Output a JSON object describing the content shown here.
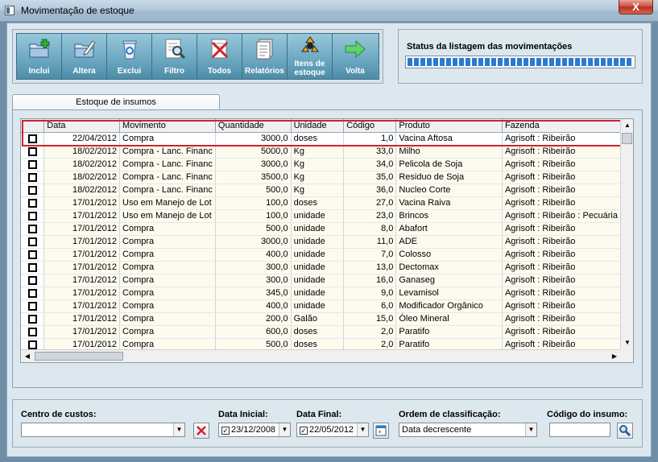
{
  "window": {
    "title": "Movimentação de estoque",
    "close_label": "X"
  },
  "toolbar": {
    "buttons": [
      {
        "label": "Inclui",
        "icon": "folder-add-icon"
      },
      {
        "label": "Altera",
        "icon": "folder-edit-icon"
      },
      {
        "label": "Exclui",
        "icon": "recycle-bin-icon"
      },
      {
        "label": "Filtro",
        "icon": "filter-magnifier-icon"
      },
      {
        "label": "Todos",
        "icon": "clear-filter-icon"
      },
      {
        "label": "Relatórios",
        "icon": "report-icon"
      },
      {
        "label": "Itens de estoque",
        "icon": "stock-items-icon"
      },
      {
        "label": "Volta",
        "icon": "arrow-back-icon"
      }
    ]
  },
  "status": {
    "title": "Status da listagem das movimentações",
    "progress": 1.0
  },
  "tab": {
    "label": "Estoque de insumos"
  },
  "grid": {
    "columns": [
      "Data",
      "Movimento",
      "Quantidade",
      "Unidade",
      "Código",
      "Produto",
      "Fazenda"
    ],
    "rows": [
      [
        "22/04/2012",
        "Compra",
        "3000,0",
        "doses",
        "1,0",
        "Vacina Aftosa",
        "Agrisoft : Ribeirão"
      ],
      [
        "18/02/2012",
        "Compra - Lanc. Financ",
        "5000,0",
        "Kg",
        "33,0",
        "Milho",
        "Agrisoft : Ribeirão"
      ],
      [
        "18/02/2012",
        "Compra - Lanc. Financ",
        "3000,0",
        "Kg",
        "34,0",
        "Pelicola de Soja",
        "Agrisoft : Ribeirão"
      ],
      [
        "18/02/2012",
        "Compra - Lanc. Financ",
        "3500,0",
        "Kg",
        "35,0",
        "Residuo de Soja",
        "Agrisoft : Ribeirão"
      ],
      [
        "18/02/2012",
        "Compra - Lanc. Financ",
        "500,0",
        "Kg",
        "36,0",
        "Nucleo Corte",
        "Agrisoft : Ribeirão"
      ],
      [
        "17/01/2012",
        "Uso em Manejo de Lot",
        "100,0",
        "doses",
        "27,0",
        "Vacina Raiva",
        "Agrisoft : Ribeirão"
      ],
      [
        "17/01/2012",
        "Uso em Manejo de Lot",
        "100,0",
        "unidade",
        "23,0",
        "Brincos",
        "Agrisoft : Ribeirão : Pecuária"
      ],
      [
        "17/01/2012",
        "Compra",
        "500,0",
        "unidade",
        "8,0",
        "Abafort",
        "Agrisoft : Ribeirão"
      ],
      [
        "17/01/2012",
        "Compra",
        "3000,0",
        "unidade",
        "11,0",
        "ADE",
        "Agrisoft : Ribeirão"
      ],
      [
        "17/01/2012",
        "Compra",
        "400,0",
        "unidade",
        "7,0",
        "Colosso",
        "Agrisoft : Ribeirão"
      ],
      [
        "17/01/2012",
        "Compra",
        "300,0",
        "unidade",
        "13,0",
        "Dectomax",
        "Agrisoft : Ribeirão"
      ],
      [
        "17/01/2012",
        "Compra",
        "300,0",
        "unidade",
        "16,0",
        "Ganaseg",
        "Agrisoft : Ribeirão"
      ],
      [
        "17/01/2012",
        "Compra",
        "345,0",
        "unidade",
        "9,0",
        "Levamisol",
        "Agrisoft : Ribeirão"
      ],
      [
        "17/01/2012",
        "Compra",
        "400,0",
        "unidade",
        "6,0",
        "Modificador Orgânico",
        "Agrisoft : Ribeirão"
      ],
      [
        "17/01/2012",
        "Compra",
        "200,0",
        "Galão",
        "15,0",
        "Óleo Mineral",
        "Agrisoft : Ribeirão"
      ],
      [
        "17/01/2012",
        "Compra",
        "600,0",
        "doses",
        "2,0",
        "Paratifo",
        "Agrisoft : Ribeirão"
      ],
      [
        "17/01/2012",
        "Compra",
        "500,0",
        "doses",
        "2,0",
        "Paratifo",
        "Agrisoft : Ribeirão"
      ]
    ]
  },
  "filters": {
    "centro_label": "Centro de custos:",
    "centro_value": "",
    "data_inicial_label": "Data Inicial:",
    "data_inicial_value": "23/12/2008",
    "data_final_label": "Data Final:",
    "data_final_value": "22/05/2012",
    "ordem_label": "Ordem de classificação:",
    "ordem_value": "Data decrescente",
    "codigo_label": "Código do insumo:",
    "codigo_value": ""
  }
}
